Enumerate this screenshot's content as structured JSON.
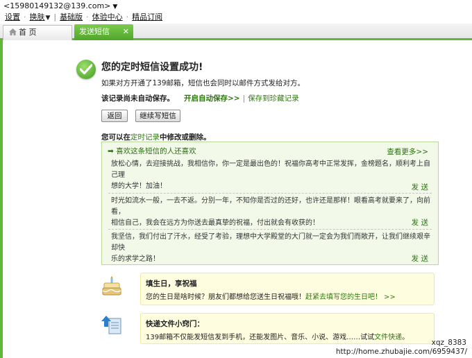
{
  "header": {
    "account": "<15980149132@139.com>",
    "links": [
      "设置",
      "换肤",
      "基础版",
      "体验中心",
      "精品订阅"
    ]
  },
  "tabs": {
    "home": "首 页",
    "active": "发送短信"
  },
  "success": {
    "title": "您的定时短信设置成功!",
    "info": "如果对方开通了139邮箱，短信也会同时以邮件方式发给对方。",
    "not_saved": "该记录尚未自动保存。",
    "auto_save": "开启自动保存>>",
    "save_to": "保存到珍藏记录"
  },
  "buttons": {
    "back": "返回",
    "continue": "继续写短信"
  },
  "edit_note": {
    "prefix": "您可以在",
    "link": "定时记录",
    "suffix": "中修改或删除。"
  },
  "recommend": {
    "heading": "➡ 喜欢这条短信的人还喜欢",
    "more": "查看更多>>",
    "send_label": "发 送",
    "messages": [
      {
        "line1": "放松心情，去迎接挑战，我相信你，你一定是最出色的！祝福你高考中正常发挥，金榜题名，顺利考上自己理",
        "line2": "想的大学！加油！"
      },
      {
        "line1": "时光如流水一般，一去不返。分别一年，不知你是否过的还好，也许还是那样！眼看高考就要来了，向前看，",
        "line2": "相信自己，我会在远方为你送去最真挚的祝福，付出就会有收获的！"
      },
      {
        "line1": "我坚信，我们付出了汗水，经受了考验，理想中大学殿堂的大门就一定会为我们而敞开，让我们继续艰辛却快",
        "line2": "乐的求学之路！"
      }
    ]
  },
  "birthday": {
    "title": "填生日，享祝福",
    "text": "您的生日是啥时候？朋友们都想给您送生日祝福哦！",
    "link": "赶紧去填写您的生日吧！",
    "arrow": ">>"
  },
  "express": {
    "title": "快递文件小窍门：",
    "text_prefix": "139邮箱不仅能发短信发到手机，还能发图片、音乐、小说、游戏……试试",
    "link": "文件快递",
    "text_suffix": "。"
  },
  "watermark": {
    "user": "xqz_8383",
    "url": "http://home.zhubajie.com/6959437/"
  }
}
